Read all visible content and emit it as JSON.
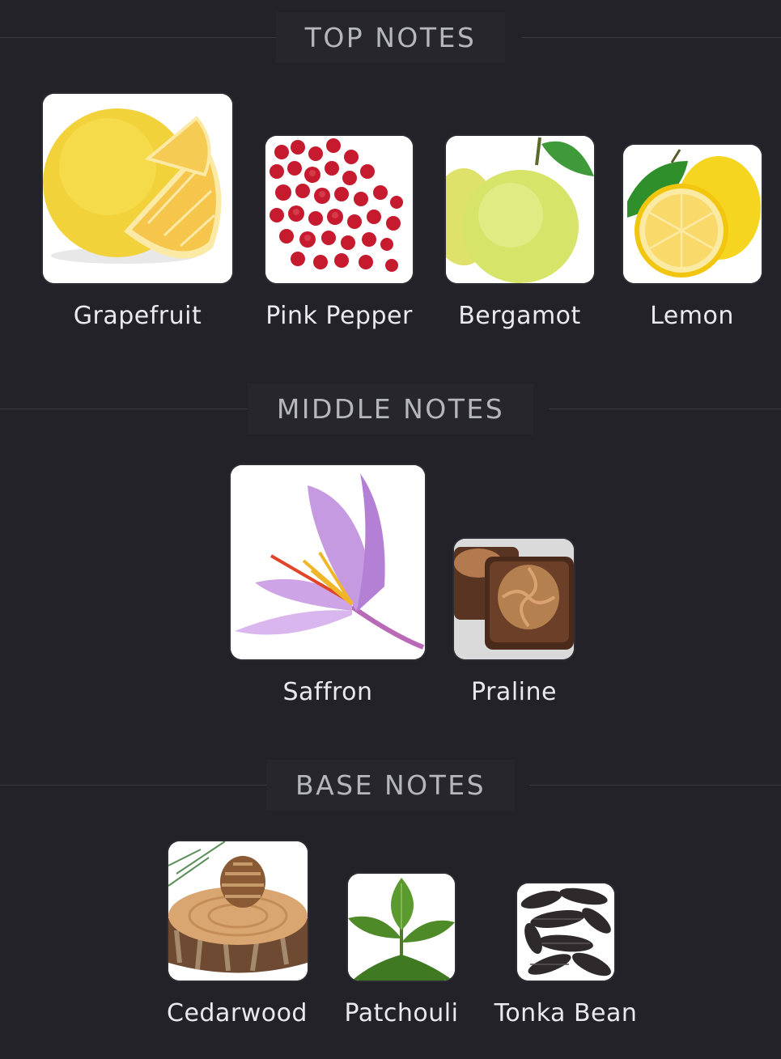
{
  "sections": {
    "top": {
      "title": "TOP NOTES",
      "notes": [
        {
          "label": "Grapefruit",
          "icon": "grapefruit-icon"
        },
        {
          "label": "Pink Pepper",
          "icon": "pink-pepper-icon"
        },
        {
          "label": "Bergamot",
          "icon": "bergamot-icon"
        },
        {
          "label": "Lemon",
          "icon": "lemon-icon"
        }
      ]
    },
    "middle": {
      "title": "MIDDLE NOTES",
      "notes": [
        {
          "label": "Saffron",
          "icon": "saffron-icon"
        },
        {
          "label": "Praline",
          "icon": "praline-icon"
        }
      ]
    },
    "base": {
      "title": "BASE NOTES",
      "notes": [
        {
          "label": "Cedarwood",
          "icon": "cedarwood-icon"
        },
        {
          "label": "Patchouli",
          "icon": "patchouli-icon"
        },
        {
          "label": "Tonka Bean",
          "icon": "tonka-bean-icon"
        }
      ]
    }
  },
  "colors": {
    "background": "#222228",
    "header_text": "#b6b6bd",
    "label_text": "#e9e9ee",
    "tile_background": "#ffffff"
  }
}
